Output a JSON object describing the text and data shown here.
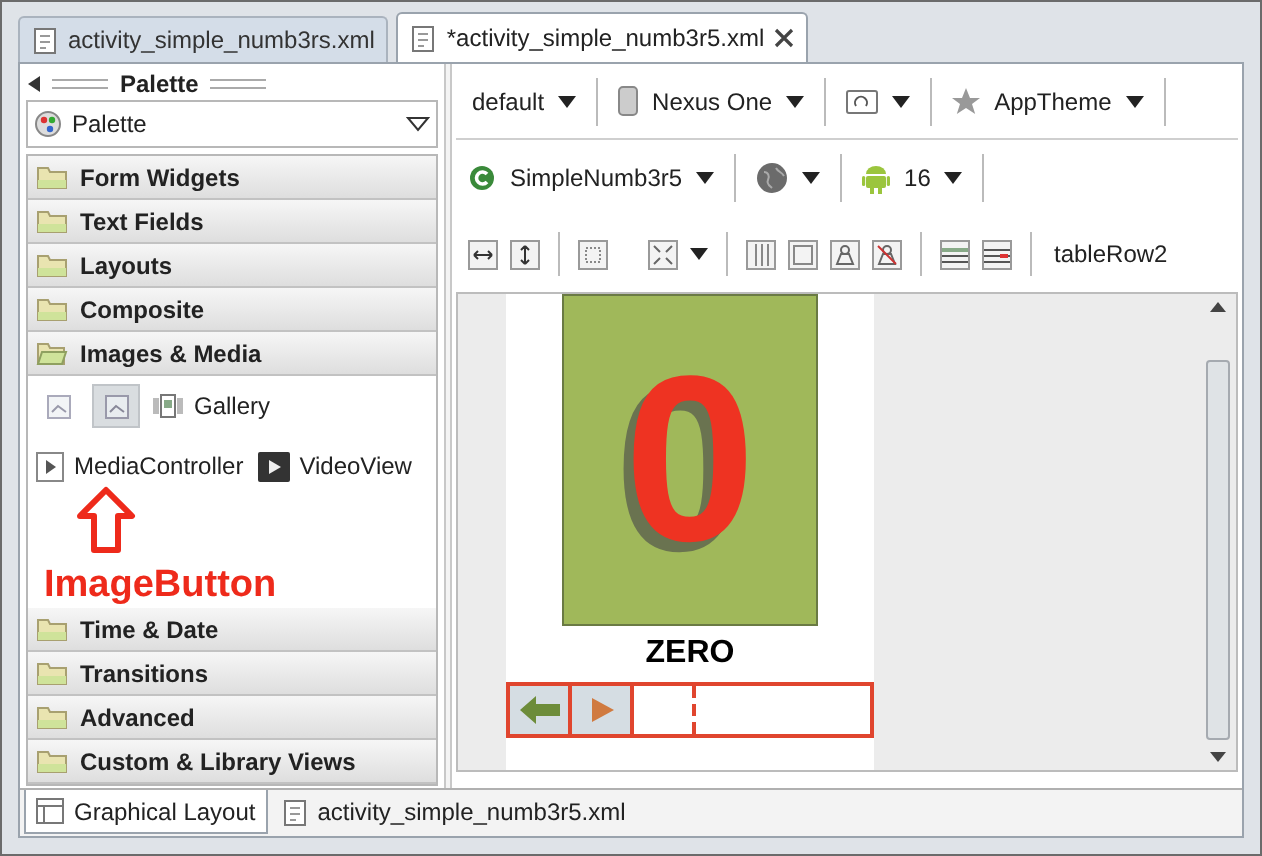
{
  "tabs": [
    {
      "label": "activity_simple_numb3rs.xml",
      "selected": false
    },
    {
      "label": "*activity_simple_numb3r5.xml",
      "selected": true
    }
  ],
  "palette": {
    "title": "Palette",
    "dropdown": "Palette",
    "categories": [
      {
        "label": "Form Widgets",
        "expanded": false
      },
      {
        "label": "Text Fields",
        "expanded": false
      },
      {
        "label": "Layouts",
        "expanded": false
      },
      {
        "label": "Composite",
        "expanded": false
      },
      {
        "label": "Images & Media",
        "expanded": true,
        "items": [
          {
            "kind": "image",
            "selected": false
          },
          {
            "kind": "image-button",
            "selected": true
          },
          {
            "kind": "gallery",
            "label": "Gallery",
            "selected": false
          },
          {
            "kind": "media-controller",
            "label": "MediaController",
            "selected": false
          },
          {
            "kind": "video",
            "label": "VideoView",
            "selected": false
          }
        ]
      },
      {
        "label": "Time & Date",
        "expanded": false
      },
      {
        "label": "Transitions",
        "expanded": false
      },
      {
        "label": "Advanced",
        "expanded": false
      },
      {
        "label": "Custom & Library Views",
        "expanded": false
      }
    ],
    "annotation": {
      "label": "ImageButton"
    }
  },
  "toolbar_rows": [
    [
      {
        "kind": "plain",
        "label": "default"
      },
      {
        "kind": "device",
        "label": "Nexus One"
      },
      {
        "kind": "orientation"
      },
      {
        "kind": "theme",
        "label": "AppTheme"
      }
    ],
    [
      {
        "kind": "activity",
        "label": "SimpleNumb3r5"
      },
      {
        "kind": "locale"
      },
      {
        "kind": "api",
        "label": "16"
      }
    ]
  ],
  "layout_toolbar": {
    "selection": "tableRow2"
  },
  "canvas": {
    "digit": "0",
    "caption": "ZERO",
    "row_buttons": [
      {
        "kind": "back"
      },
      {
        "kind": "play"
      },
      {
        "kind": "empty"
      }
    ]
  },
  "bottom_tabs": [
    {
      "label": "Graphical Layout",
      "selected": true
    },
    {
      "label": "activity_simple_numb3r5.xml",
      "selected": false
    }
  ]
}
